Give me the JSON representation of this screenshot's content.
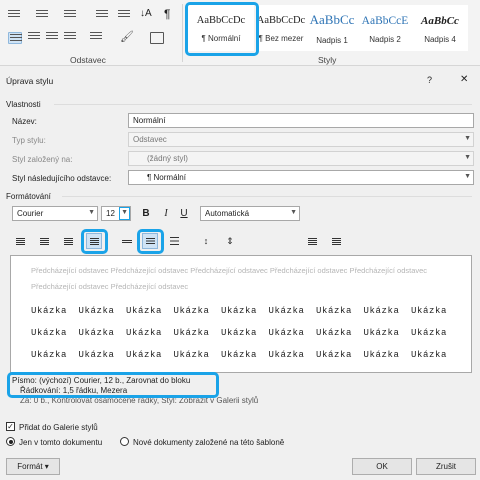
{
  "ribbon": {
    "groups": {
      "paragraph": "Odstavec",
      "styles": "Styly"
    },
    "styles": [
      {
        "sample": "AaBbCcDc",
        "name": "¶ Normální"
      },
      {
        "sample": "AaBbCcDc",
        "name": "¶ Bez mezer"
      },
      {
        "sample": "AaBbCc",
        "name": "Nadpis 1"
      },
      {
        "sample": "AaBbCcE",
        "name": "Nadpis 2"
      },
      {
        "sample": "AaBbCc",
        "name": "Nadpis 4"
      }
    ]
  },
  "dialog": {
    "title": "Úprava stylu",
    "help": "?",
    "close": "✕",
    "properties_heading": "Vlastnosti",
    "name_label": "Název:",
    "name_value": "Normální",
    "type_label": "Typ stylu:",
    "type_value": "Odstavec",
    "based_label": "Styl založený na:",
    "based_value": "(žádný styl)",
    "next_label": "Styl následujícího odstavce:",
    "next_value": "¶ Normální",
    "formatting_heading": "Formátování",
    "font_value": "Courier",
    "size_value": "12",
    "bold": "B",
    "italic": "I",
    "underline": "U",
    "color_value": "Automatická",
    "preview": {
      "prev_line1": "Předcházející odstavec Předcházející odstavec Předcházející odstavec Předcházející odstavec Předcházející odstavec",
      "prev_line2": "Předcházející odstavec Předcházející odstavec",
      "sample_word": "Ukázka"
    },
    "description_line1": "Písmo: (výchozí) Courier, 12 b., Zarovnat do bloku",
    "description_line2": "Řádkování:  1,5 řádku, Mezera",
    "description_line3": "Za:  0 b., Kontrolovat osamocené řádky, Styl: Zobrazit v Galerii stylů",
    "add_gallery": "Přidat do Galerie stylů",
    "only_doc": "Jen v tomto dokumentu",
    "new_docs": "Nové dokumenty založené na této šabloně",
    "format_btn": "Formát ▾",
    "ok_btn": "OK",
    "cancel_btn": "Zrušit"
  },
  "colors": {
    "highlight": "#1aa3e8"
  }
}
